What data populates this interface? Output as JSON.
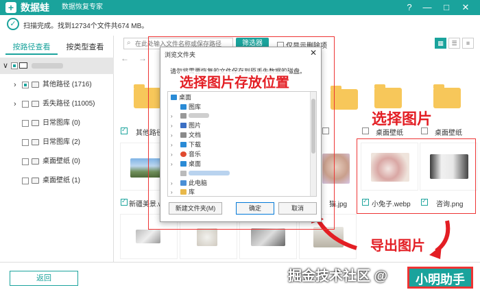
{
  "app": {
    "name": "数据蛙",
    "subtitle": "数据恢复专家",
    "logo_glyph": "+"
  },
  "window_buttons": {
    "help": "?",
    "minimize": "—",
    "restore": "□",
    "close": "✕"
  },
  "status": {
    "text": "扫描完成。找到12734个文件共674 MB。"
  },
  "sidebar": {
    "tabs": [
      {
        "label": "按路径查看",
        "active": true
      },
      {
        "label": "按类型查看",
        "active": false
      }
    ],
    "items": [
      {
        "label": "其他路径 (1716)",
        "expandable": true,
        "state": "partial"
      },
      {
        "label": "丢失路径 (11005)",
        "expandable": true,
        "state": "none"
      },
      {
        "label": "日常图库 (0)",
        "expandable": false,
        "state": "none"
      },
      {
        "label": "日常图库 (2)",
        "expandable": false,
        "state": "none"
      },
      {
        "label": "桌面壁纸 (0)",
        "expandable": false,
        "state": "none"
      },
      {
        "label": "桌面壁纸 (1)",
        "expandable": false,
        "state": "none"
      }
    ]
  },
  "toolbar": {
    "search_placeholder": "在此处输入文件名称或保存路径",
    "filter_label": "筛选器",
    "only_deleted_label": "仅显示删除项"
  },
  "grid": {
    "row1": [
      {
        "label": "其他路径"
      },
      {
        "label": "桌面壁纸"
      },
      {
        "label": "桌面壁纸"
      }
    ],
    "row2": [
      {
        "label": "新疆美景.webp",
        "checked": true
      },
      {
        "label": "猫.jpg",
        "checked": false
      },
      {
        "label": "小兔子.webp",
        "checked": true
      },
      {
        "label": "咨询.png",
        "checked": true
      }
    ]
  },
  "dialog": {
    "title": "浏览文件夹",
    "message": "请勿将需要恢复的文件保存到原丢失数据的磁盘。",
    "tree": [
      {
        "label": "桌面",
        "icon_color": "#2a8bd6"
      },
      {
        "label": "图库",
        "icon_color": "#2a8bd6"
      },
      {
        "label": "图片",
        "icon_color": "#3b6fc4"
      },
      {
        "label": "文档",
        "icon_color": "#8a8a8a"
      },
      {
        "label": "下载",
        "icon_color": "#2a8bd6"
      },
      {
        "label": "音乐",
        "icon_color": "#e04a2f"
      },
      {
        "label": "桌面",
        "icon_color": "#2a8bd6"
      },
      {
        "label": "此电脑",
        "icon_color": "#4a8fd6"
      },
      {
        "label": "库",
        "icon_color": "#e8b84a"
      }
    ],
    "new_folder_label": "新建文件夹(M)",
    "ok_label": "确定",
    "cancel_label": "取消",
    "close_glyph": "✕"
  },
  "annotations": {
    "dialog_hint": "选择图片存放位置",
    "select_hint": "选择图片",
    "export_hint": "导出图片"
  },
  "footer": {
    "back_label": "返回",
    "export_label": "小明助手",
    "watermark": "掘金技术社区 @"
  },
  "colors": {
    "accent": "#1aa39c",
    "annotation_red": "#e31e24",
    "folder": "#f7c75a"
  }
}
